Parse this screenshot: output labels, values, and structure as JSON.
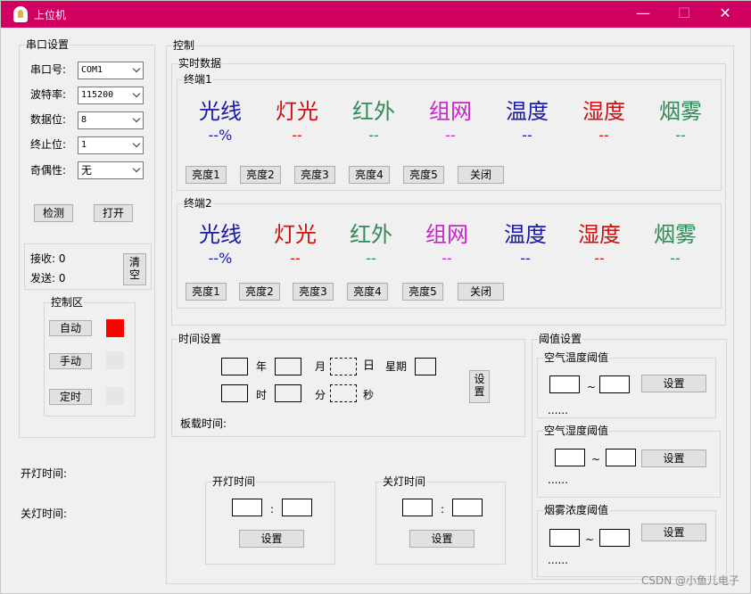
{
  "window": {
    "title": "上位机",
    "min": "—",
    "max": "☐",
    "close": "✕"
  },
  "serial": {
    "title": "串口设置",
    "port": {
      "label": "串口号:",
      "value": "COM1"
    },
    "baud": {
      "label": "波特率:",
      "value": "115200"
    },
    "databits": {
      "label": "数据位:",
      "value": "8"
    },
    "stopbits": {
      "label": "终止位:",
      "value": "1"
    },
    "parity": {
      "label": "奇偶性:",
      "value": "无"
    },
    "detect": "检测",
    "open": "打开",
    "recv": "接收: 0",
    "send": "发送: 0",
    "clear": "清空"
  },
  "ctrlzone": {
    "title": "控制区",
    "auto": "自动",
    "manual": "手动",
    "timer": "定时",
    "auto_color": "#ff0000",
    "idle_color": "#e6e6e6"
  },
  "left_times": {
    "on": "开灯时间:",
    "off": "关灯时间:"
  },
  "control": {
    "title": "控制",
    "realtime": "实时数据"
  },
  "terminals": [
    {
      "title": "终端1",
      "sensors": [
        {
          "name": "光线",
          "value": "--%",
          "color": "#1a1aa6"
        },
        {
          "name": "灯光",
          "value": "--",
          "color": "#cc1111"
        },
        {
          "name": "红外",
          "value": "--",
          "color": "#2e8b57"
        },
        {
          "name": "组网",
          "value": "--",
          "color": "#cc22cc"
        },
        {
          "name": "温度",
          "value": "--",
          "color": "#1a1aa6"
        },
        {
          "name": "湿度",
          "value": "--",
          "color": "#cc1111"
        },
        {
          "name": "烟雾",
          "value": "--",
          "color": "#2e8b57"
        }
      ],
      "buttons": [
        "亮度1",
        "亮度2",
        "亮度3",
        "亮度4",
        "亮度5",
        "关闭"
      ]
    },
    {
      "title": "终端2",
      "sensors": [
        {
          "name": "光线",
          "value": "--%",
          "color": "#1a1aa6"
        },
        {
          "name": "灯光",
          "value": "--",
          "color": "#cc1111"
        },
        {
          "name": "红外",
          "value": "--",
          "color": "#2e8b57"
        },
        {
          "name": "组网",
          "value": "--",
          "color": "#cc22cc"
        },
        {
          "name": "温度",
          "value": "--",
          "color": "#1a1aa6"
        },
        {
          "name": "湿度",
          "value": "--",
          "color": "#cc1111"
        },
        {
          "name": "烟雾",
          "value": "--",
          "color": "#2e8b57"
        }
      ],
      "buttons": [
        "亮度1",
        "亮度2",
        "亮度3",
        "亮度4",
        "亮度5",
        "关闭"
      ]
    }
  ],
  "timeset": {
    "title": "时间设置",
    "year": "年",
    "month": "月",
    "day": "日",
    "weekday": "星期",
    "hour": "时",
    "minute": "分",
    "second": "秒",
    "set": "设置",
    "board_time": "板载时间:"
  },
  "lights": {
    "on_title": "开灯时间",
    "off_title": "关灯时间",
    "colon": ":",
    "set": "设置"
  },
  "threshold": {
    "title": "阈值设置",
    "items": [
      {
        "title": "空气温度阈值",
        "sep": "~",
        "set": "设置",
        "dots": "......"
      },
      {
        "title": "空气湿度阈值",
        "sep": "~",
        "set": "设置",
        "dots": "......"
      },
      {
        "title": "烟雾浓度阈值",
        "sep": "~",
        "set": "设置",
        "dots": "......"
      }
    ]
  },
  "watermark": "CSDN @小鱼儿电子"
}
